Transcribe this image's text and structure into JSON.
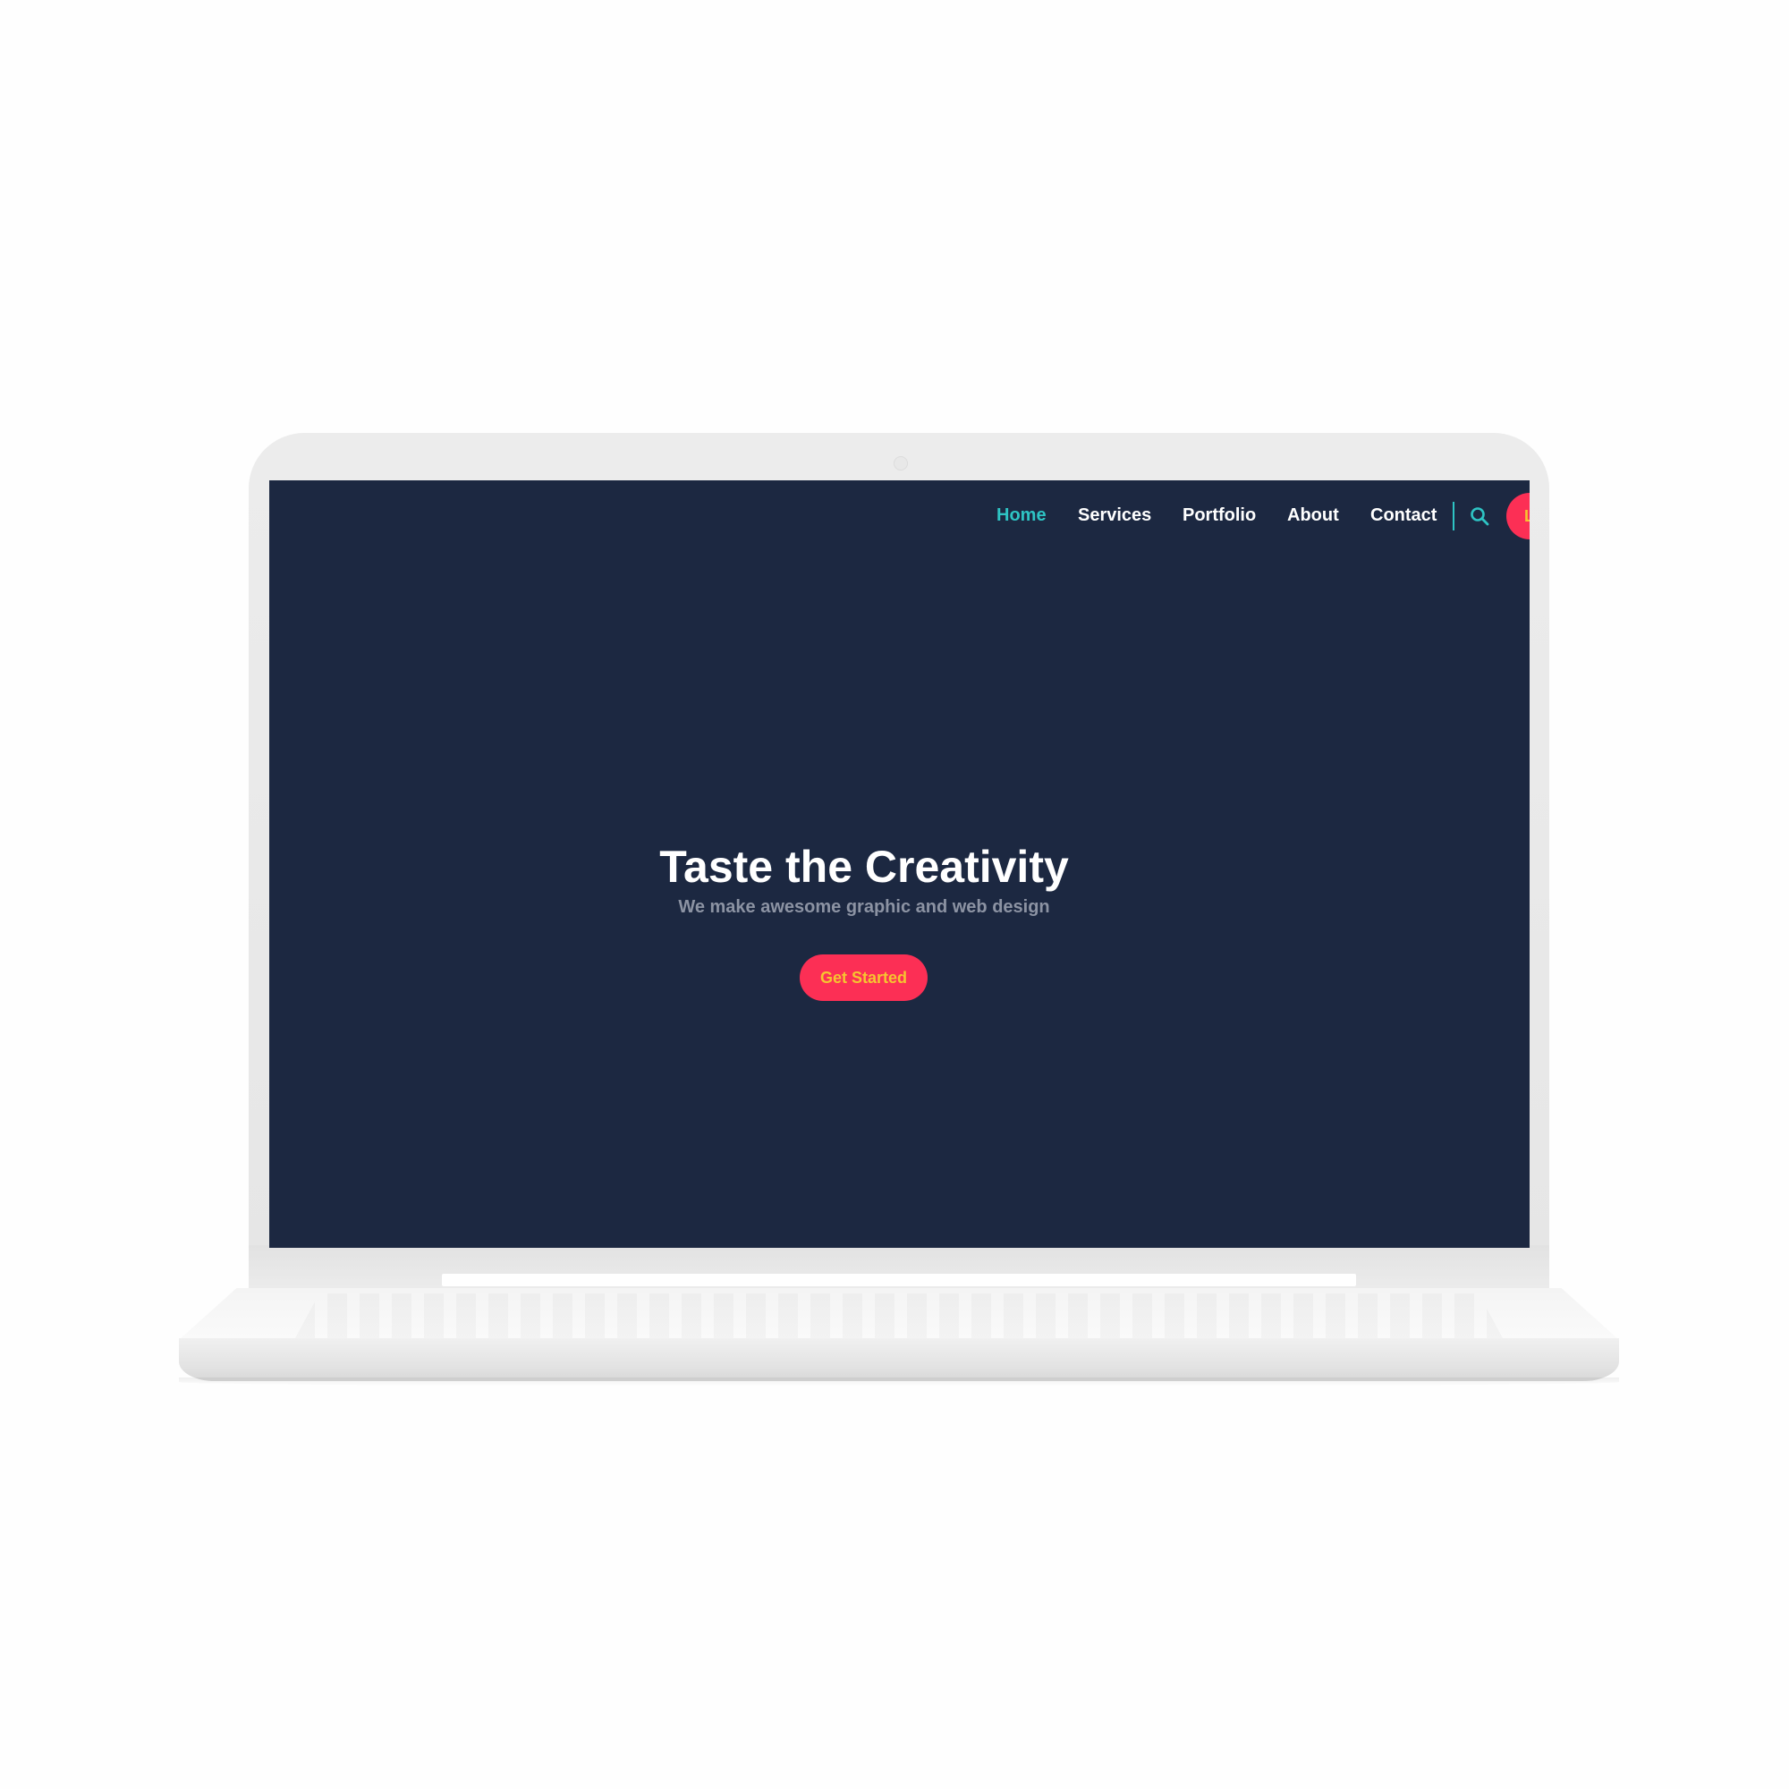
{
  "nav": {
    "links": [
      {
        "label": "Home",
        "active": true
      },
      {
        "label": "Services",
        "active": false
      },
      {
        "label": "Portfolio",
        "active": false
      },
      {
        "label": "About",
        "active": false
      },
      {
        "label": "Contact",
        "active": false
      }
    ],
    "search_icon": "search-icon",
    "cta_label": "L"
  },
  "hero": {
    "title": "Taste the Creativity",
    "subtitle": "We make awesome graphic and web design",
    "button_label": "Get Started"
  },
  "colors": {
    "screen_background": "#1c2841",
    "accent_teal": "#2ec4c4",
    "button_red": "#fc2f55",
    "button_text": "#f6c430",
    "subtitle_gray": "#8c93a3"
  }
}
